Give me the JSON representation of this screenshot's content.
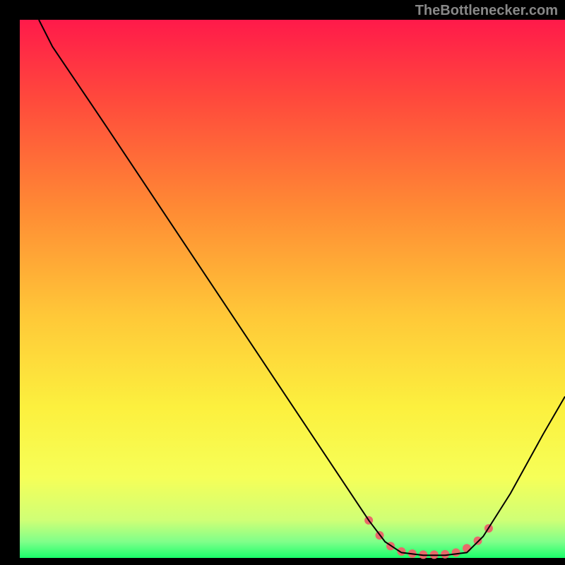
{
  "watermark": "TheBottlenecker.com",
  "chart_data": {
    "type": "line",
    "title": "",
    "xlabel": "",
    "ylabel": "",
    "xlim": [
      0,
      100
    ],
    "ylim": [
      0,
      100
    ],
    "background": {
      "type": "vertical-gradient",
      "stops": [
        {
          "offset": 0.0,
          "color": "#ff1a4a"
        },
        {
          "offset": 0.15,
          "color": "#ff4a3c"
        },
        {
          "offset": 0.35,
          "color": "#ff8a34"
        },
        {
          "offset": 0.55,
          "color": "#ffc838"
        },
        {
          "offset": 0.72,
          "color": "#fcf03e"
        },
        {
          "offset": 0.85,
          "color": "#f6ff58"
        },
        {
          "offset": 0.93,
          "color": "#cfff76"
        },
        {
          "offset": 0.97,
          "color": "#7fff8a"
        },
        {
          "offset": 1.0,
          "color": "#1aff6a"
        }
      ]
    },
    "series": [
      {
        "name": "bottleneck-curve",
        "color": "#000000",
        "width": 2,
        "points": [
          {
            "x": 3.5,
            "y": 100
          },
          {
            "x": 6,
            "y": 95
          },
          {
            "x": 10,
            "y": 89
          },
          {
            "x": 16,
            "y": 80
          },
          {
            "x": 64,
            "y": 7
          },
          {
            "x": 67,
            "y": 3
          },
          {
            "x": 70,
            "y": 1
          },
          {
            "x": 74,
            "y": 0.5
          },
          {
            "x": 78,
            "y": 0.5
          },
          {
            "x": 82,
            "y": 1
          },
          {
            "x": 85,
            "y": 4
          },
          {
            "x": 90,
            "y": 12
          },
          {
            "x": 96,
            "y": 23
          },
          {
            "x": 100,
            "y": 30
          }
        ]
      },
      {
        "name": "highlight-dots",
        "color": "#e86a6a",
        "marker_radius": 6,
        "points": [
          {
            "x": 64,
            "y": 7
          },
          {
            "x": 66,
            "y": 4.2
          },
          {
            "x": 68,
            "y": 2.2
          },
          {
            "x": 70,
            "y": 1.2
          },
          {
            "x": 72,
            "y": 0.8
          },
          {
            "x": 74,
            "y": 0.6
          },
          {
            "x": 76,
            "y": 0.6
          },
          {
            "x": 78,
            "y": 0.7
          },
          {
            "x": 80,
            "y": 1.0
          },
          {
            "x": 82,
            "y": 1.8
          },
          {
            "x": 84,
            "y": 3.2
          },
          {
            "x": 86,
            "y": 5.5
          }
        ]
      }
    ]
  }
}
